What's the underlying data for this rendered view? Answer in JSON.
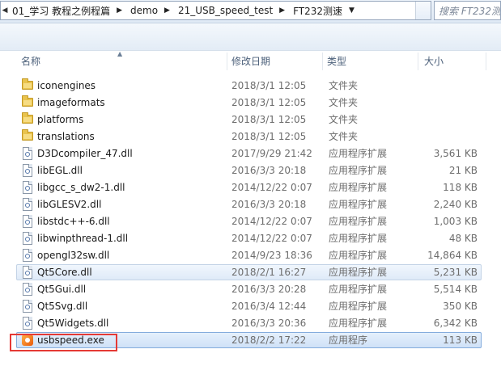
{
  "address_bar": {
    "crumbs": [
      "01_学习 教程之例程篇",
      "demo",
      "21_USB_speed_test",
      "FT232测速"
    ]
  },
  "search": {
    "placeholder": "搜索 FT232测"
  },
  "columns": {
    "name": "名称",
    "date": "修改日期",
    "type": "类型",
    "size": "大小"
  },
  "files": [
    {
      "name": "iconengines",
      "date": "2018/3/1 12:05",
      "type": "文件夹",
      "size": "",
      "icon": "folder-icon"
    },
    {
      "name": "imageformats",
      "date": "2018/3/1 12:05",
      "type": "文件夹",
      "size": "",
      "icon": "folder-icon"
    },
    {
      "name": "platforms",
      "date": "2018/3/1 12:05",
      "type": "文件夹",
      "size": "",
      "icon": "folder-icon"
    },
    {
      "name": "translations",
      "date": "2018/3/1 12:05",
      "type": "文件夹",
      "size": "",
      "icon": "folder-icon"
    },
    {
      "name": "D3Dcompiler_47.dll",
      "date": "2017/9/29 21:42",
      "type": "应用程序扩展",
      "size": "3,561 KB",
      "icon": "dll-icon"
    },
    {
      "name": "libEGL.dll",
      "date": "2016/3/3 20:18",
      "type": "应用程序扩展",
      "size": "21 KB",
      "icon": "dll-icon"
    },
    {
      "name": "libgcc_s_dw2-1.dll",
      "date": "2014/12/22 0:07",
      "type": "应用程序扩展",
      "size": "118 KB",
      "icon": "dll-icon"
    },
    {
      "name": "libGLESV2.dll",
      "date": "2016/3/3 20:18",
      "type": "应用程序扩展",
      "size": "2,240 KB",
      "icon": "dll-icon"
    },
    {
      "name": "libstdc++-6.dll",
      "date": "2014/12/22 0:07",
      "type": "应用程序扩展",
      "size": "1,003 KB",
      "icon": "dll-icon"
    },
    {
      "name": "libwinpthread-1.dll",
      "date": "2014/12/22 0:07",
      "type": "应用程序扩展",
      "size": "48 KB",
      "icon": "dll-icon"
    },
    {
      "name": "opengl32sw.dll",
      "date": "2014/9/23 18:36",
      "type": "应用程序扩展",
      "size": "14,864 KB",
      "icon": "dll-icon"
    },
    {
      "name": "Qt5Core.dll",
      "date": "2018/2/1 16:27",
      "type": "应用程序扩展",
      "size": "5,231 KB",
      "icon": "dll-icon"
    },
    {
      "name": "Qt5Gui.dll",
      "date": "2016/3/3 20:28",
      "type": "应用程序扩展",
      "size": "5,514 KB",
      "icon": "dll-icon"
    },
    {
      "name": "Qt5Svg.dll",
      "date": "2016/3/4 12:44",
      "type": "应用程序扩展",
      "size": "350 KB",
      "icon": "dll-icon"
    },
    {
      "name": "Qt5Widgets.dll",
      "date": "2016/3/3 20:36",
      "type": "应用程序扩展",
      "size": "6,342 KB",
      "icon": "dll-icon"
    },
    {
      "name": "usbspeed.exe",
      "date": "2018/2/2 17:22",
      "type": "应用程序",
      "size": "113 KB",
      "icon": "exe-icon"
    }
  ],
  "colors": {
    "highlight_box": "#e53935",
    "selection": "#cfe1f7"
  }
}
